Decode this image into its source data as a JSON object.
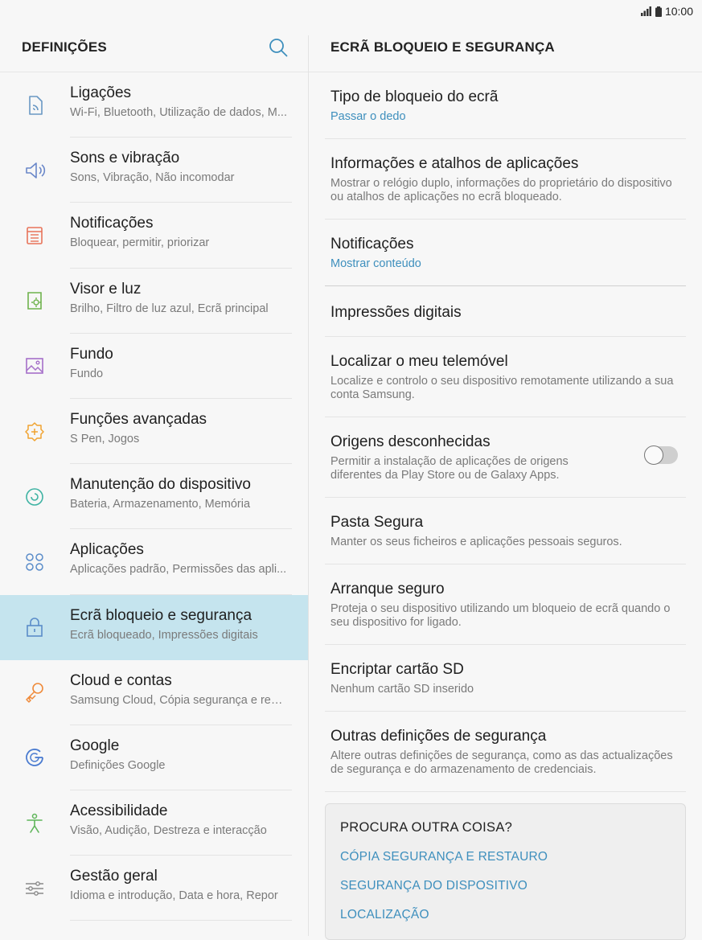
{
  "status": {
    "time": "10:00"
  },
  "left": {
    "title": "DEFINIÇÕES",
    "items": [
      {
        "title": "Ligações",
        "subtitle": "Wi-Fi, Bluetooth, Utilização de dados, M...",
        "icon": "connections-icon",
        "color": "#6a98c4"
      },
      {
        "title": "Sons e vibração",
        "subtitle": "Sons, Vibração, Não incomodar",
        "icon": "speaker-icon",
        "color": "#6a87c9"
      },
      {
        "title": "Notificações",
        "subtitle": "Bloquear, permitir, priorizar",
        "icon": "notifications-icon",
        "color": "#e8745a"
      },
      {
        "title": "Visor e luz",
        "subtitle": "Brilho, Filtro de luz azul, Ecrã principal",
        "icon": "display-icon",
        "color": "#6fb34d"
      },
      {
        "title": "Fundo",
        "subtitle": "Fundo",
        "icon": "wallpaper-icon",
        "color": "#a56fc9"
      },
      {
        "title": "Funções avançadas",
        "subtitle": "S Pen, Jogos",
        "icon": "advanced-features-icon",
        "color": "#f0a330"
      },
      {
        "title": "Manutenção do dispositivo",
        "subtitle": "Bateria, Armazenamento, Memória",
        "icon": "device-maintenance-icon",
        "color": "#3fb3a3"
      },
      {
        "title": "Aplicações",
        "subtitle": "Aplicações padrão, Permissões das apli...",
        "icon": "apps-icon",
        "color": "#5a8cc9"
      },
      {
        "title": "Ecrã bloqueio e segurança",
        "subtitle": "Ecrã bloqueado, Impressões digitais",
        "icon": "lock-icon",
        "color": "#5a8cc9"
      },
      {
        "title": "Cloud e contas",
        "subtitle": "Samsung Cloud, Cópia segurança e rest...",
        "icon": "key-icon",
        "color": "#ef8a3a"
      },
      {
        "title": "Google",
        "subtitle": "Definições Google",
        "icon": "google-icon",
        "color": "#4a7bd0"
      },
      {
        "title": "Acessibilidade",
        "subtitle": "Visão, Audição, Destreza e interacção",
        "icon": "accessibility-icon",
        "color": "#5fb55a"
      },
      {
        "title": "Gestão geral",
        "subtitle": "Idioma e introdução, Data e hora, Repor",
        "icon": "sliders-icon",
        "color": "#8a8a8a"
      }
    ]
  },
  "right": {
    "title": "ECRÃ BLOQUEIO E SEGURANÇA",
    "items": [
      {
        "title": "Tipo de bloqueio do ecrã",
        "subtitle": "Passar o dedo",
        "accent": true
      },
      {
        "title": "Informações e atalhos de aplicações",
        "subtitle": "Mostrar o relógio duplo, informações do proprietário do dispositivo ou atalhos de aplicações no ecrã bloqueado."
      },
      {
        "title": "Notificações",
        "subtitle": "Mostrar conteúdo",
        "accent": true
      },
      {
        "title": "Impressões digitais",
        "subtitle": ""
      },
      {
        "title": "Localizar o meu telemóvel",
        "subtitle": "Localize e controlo o seu dispositivo remotamente utilizando a sua conta Samsung."
      },
      {
        "title": "Origens desconhecidas",
        "subtitle": "Permitir a instalação de aplicações de origens diferentes da Play Store ou de Galaxy Apps.",
        "toggle": false
      },
      {
        "title": "Pasta Segura",
        "subtitle": "Manter os seus ficheiros e aplicações pessoais seguros."
      },
      {
        "title": "Arranque seguro",
        "subtitle": "Proteja o seu dispositivo utilizando um bloqueio de ecrã quando o seu dispositivo for ligado."
      },
      {
        "title": "Encriptar cartão SD",
        "subtitle": "Nenhum cartão SD inserido"
      },
      {
        "title": "Outras definições de segurança",
        "subtitle": "Altere outras definições de segurança, como as das actualizações de segurança e do armazenamento de credenciais."
      }
    ],
    "lookfor": {
      "title": "PROCURA OUTRA COISA?",
      "links": [
        "CÓPIA SEGURANÇA E RESTAURO",
        "SEGURANÇA DO DISPOSITIVO",
        "LOCALIZAÇÃO"
      ]
    }
  },
  "colors": {
    "accent": "#3e8fbd",
    "selected_bg": "#c5e4ee"
  }
}
